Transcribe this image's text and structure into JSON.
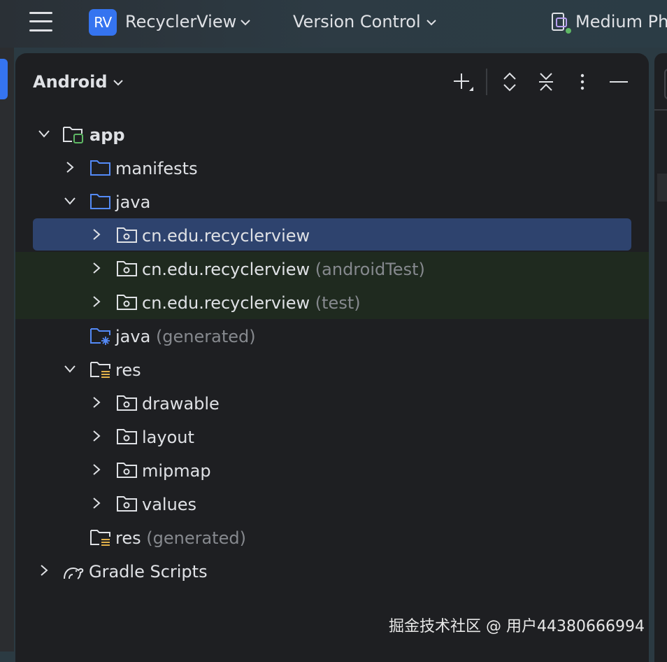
{
  "titlebar": {
    "project_badge": "RV",
    "project_name": "RecyclerView",
    "vcs_label": "Version Control",
    "device_label": "Medium Ph"
  },
  "panel": {
    "title": "Android"
  },
  "tree": {
    "app": "app",
    "manifests": "manifests",
    "java": "java",
    "pkg_main": "cn.edu.recyclerview",
    "pkg_android_test": "cn.edu.recyclerview",
    "pkg_android_test_suffix": "(androidTest)",
    "pkg_test": "cn.edu.recyclerview",
    "pkg_test_suffix": "(test)",
    "java_generated": "java",
    "java_generated_suffix": "(generated)",
    "res": "res",
    "drawable": "drawable",
    "layout": "layout",
    "mipmap": "mipmap",
    "values": "values",
    "res_generated": "res",
    "res_generated_suffix": "(generated)",
    "gradle_scripts": "Gradle Scripts"
  },
  "watermark": "掘金技术社区 @ 用户44380666994",
  "colors": {
    "accent": "#3574f0",
    "selection": "#2e436e",
    "panel_bg": "#1e1f22",
    "test_row_bg": "#1f2a1f"
  },
  "icons": [
    "hamburger-menu-icon",
    "chevron-down-icon",
    "device-icon",
    "plus-icon",
    "expand-all-icon",
    "collapse-all-icon",
    "more-options-icon",
    "minimize-icon",
    "folder-icon",
    "package-folder-icon",
    "gradle-icon"
  ]
}
